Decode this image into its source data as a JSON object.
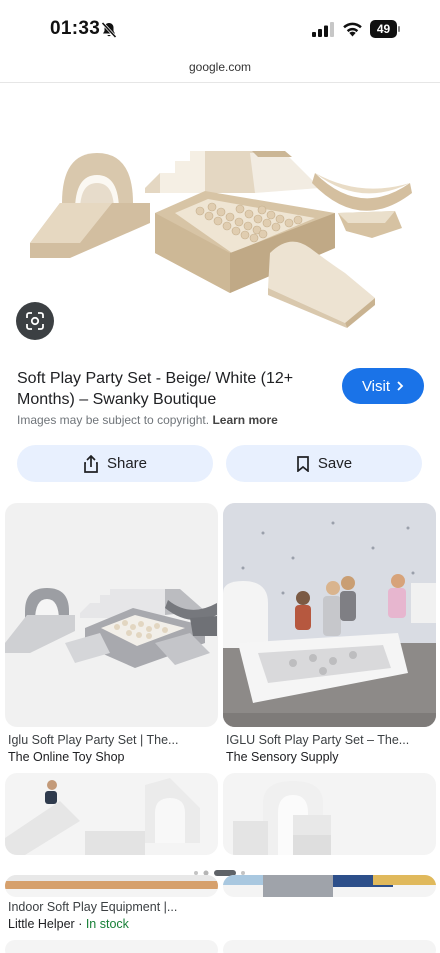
{
  "status_bar": {
    "time": "01:33",
    "battery": "49"
  },
  "url": "google.com",
  "result": {
    "title": "Soft Play Party Set - Beige/ White (12+ Months) – Swanky Boutique",
    "visit_label": "Visit",
    "copyright_text": "Images may be subject to copyright.",
    "learn_more": "Learn more",
    "share_label": "Share",
    "save_label": "Save"
  },
  "related": [
    {
      "title": "Iglu Soft Play Party Set | The...",
      "source": "The Online Toy Shop"
    },
    {
      "title": "IGLU Soft Play Party Set – The...",
      "source": "The Sensory Supply"
    },
    {
      "title": "Indoor Soft Play Equipment |...",
      "source": "Little Helper",
      "stock": "In stock"
    }
  ],
  "colors": {
    "accent": "#1a73e8",
    "button_bg": "#e8f0fe",
    "in_stock": "#188038"
  }
}
